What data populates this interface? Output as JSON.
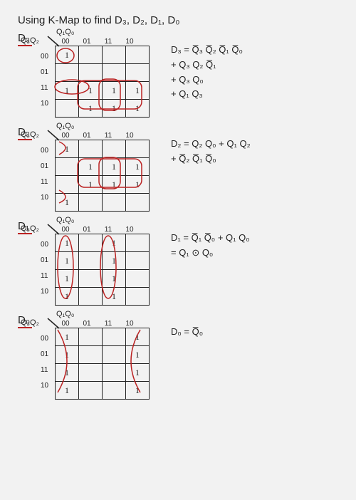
{
  "title": "Using K-Map to find D₃, D₂, D₁, D₀",
  "axis_top": "Q₁Q₀",
  "axis_left": "Q₃Q₂",
  "col_codes": [
    "00",
    "01",
    "11",
    "10"
  ],
  "row_codes": [
    "00",
    "01",
    "11",
    "10"
  ],
  "sections": [
    {
      "name": "D₃",
      "cells": [
        [
          "1",
          "",
          "",
          ""
        ],
        [
          "",
          "",
          "",
          ""
        ],
        [
          "1",
          "1",
          "1",
          "1"
        ],
        [
          "",
          "1",
          "1",
          "1"
        ]
      ],
      "eq": [
        "D₃ = Q̅₃ Q̅₂ Q̅₁ Q̅₀",
        "     + Q₃ Q₂ Q̅₁",
        "     + Q₃ Q₀",
        "     + Q₁ Q₃"
      ]
    },
    {
      "name": "D₂",
      "cells": [
        [
          "1",
          "",
          "",
          ""
        ],
        [
          "",
          "1",
          "1",
          "1"
        ],
        [
          "",
          "1",
          "1",
          "1"
        ],
        [
          "1",
          "",
          "",
          ""
        ]
      ],
      "eq": [
        "D₂ = Q₂ Q₀ + Q₁ Q₂",
        "     + Q̅₂ Q̅₁ Q̅₀"
      ]
    },
    {
      "name": "D₁",
      "cells": [
        [
          "1",
          "",
          "1",
          ""
        ],
        [
          "1",
          "",
          "1",
          ""
        ],
        [
          "1",
          "",
          "1",
          ""
        ],
        [
          "1",
          "",
          "1",
          ""
        ]
      ],
      "eq": [
        "D₁ = Q̅₁ Q̅₀ + Q₁ Q₀",
        "   = Q₁ ⊙ Q₀"
      ]
    },
    {
      "name": "D₀",
      "cells": [
        [
          "1",
          "",
          "",
          "1"
        ],
        [
          "1",
          "",
          "",
          "1"
        ],
        [
          "1",
          "",
          "",
          "1"
        ],
        [
          "1",
          "",
          "",
          "1"
        ]
      ],
      "eq": [
        "D₀ = Q̅₀"
      ]
    }
  ],
  "chart_data": [
    {
      "type": "table",
      "title": "D3 K-Map",
      "categories_cols": [
        "00",
        "01",
        "11",
        "10"
      ],
      "categories_rows": [
        "00",
        "01",
        "11",
        "10"
      ],
      "values": [
        [
          1,
          0,
          0,
          0
        ],
        [
          0,
          0,
          0,
          0
        ],
        [
          1,
          1,
          1,
          1
        ],
        [
          0,
          1,
          1,
          1
        ]
      ]
    },
    {
      "type": "table",
      "title": "D2 K-Map",
      "categories_cols": [
        "00",
        "01",
        "11",
        "10"
      ],
      "categories_rows": [
        "00",
        "01",
        "11",
        "10"
      ],
      "values": [
        [
          1,
          0,
          0,
          0
        ],
        [
          0,
          1,
          1,
          1
        ],
        [
          0,
          1,
          1,
          1
        ],
        [
          1,
          0,
          0,
          0
        ]
      ]
    },
    {
      "type": "table",
      "title": "D1 K-Map",
      "categories_cols": [
        "00",
        "01",
        "11",
        "10"
      ],
      "categories_rows": [
        "00",
        "01",
        "11",
        "10"
      ],
      "values": [
        [
          1,
          0,
          1,
          0
        ],
        [
          1,
          0,
          1,
          0
        ],
        [
          1,
          0,
          1,
          0
        ],
        [
          1,
          0,
          1,
          0
        ]
      ]
    },
    {
      "type": "table",
      "title": "D0 K-Map",
      "categories_cols": [
        "00",
        "01",
        "11",
        "10"
      ],
      "categories_rows": [
        "00",
        "01",
        "11",
        "10"
      ],
      "values": [
        [
          1,
          0,
          0,
          1
        ],
        [
          1,
          0,
          0,
          1
        ],
        [
          1,
          0,
          0,
          1
        ],
        [
          1,
          0,
          0,
          1
        ]
      ]
    }
  ]
}
